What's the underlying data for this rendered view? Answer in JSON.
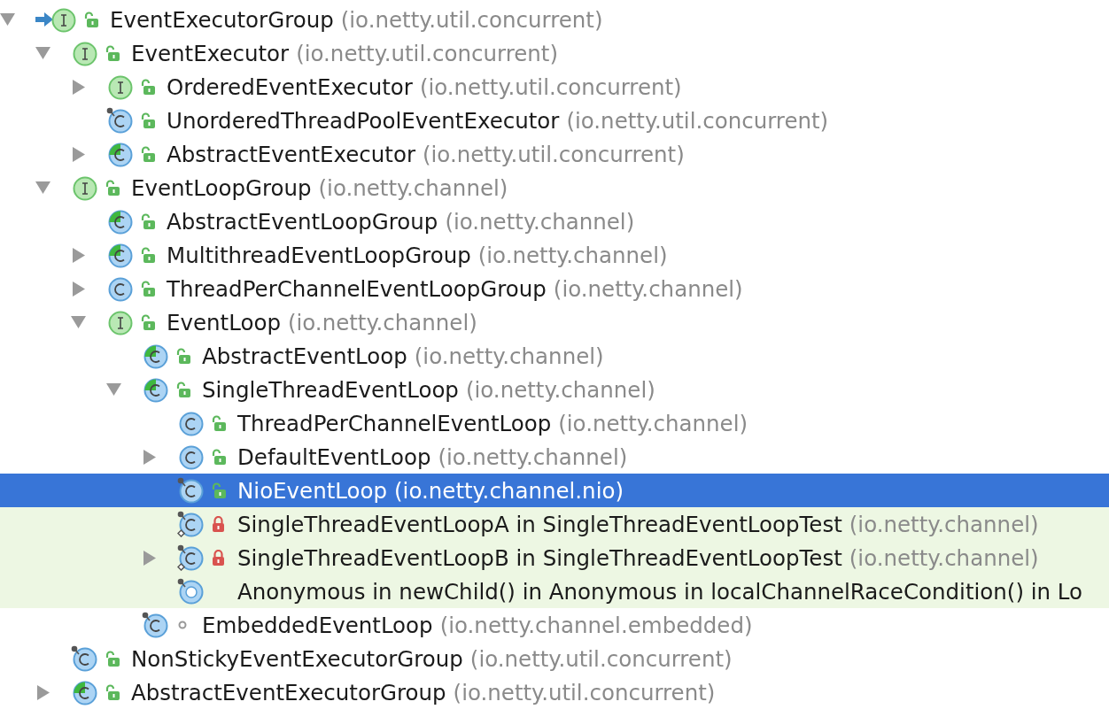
{
  "tree": [
    {
      "name": "EventExecutorGroup",
      "package": "(io.netty.util.concurrent)",
      "kind": "interface",
      "modifier": {
        "kind": "public"
      },
      "base": true,
      "final": false,
      "selected": false,
      "expanded": true,
      "children": [
        {
          "name": "EventExecutor",
          "package": "(io.netty.util.concurrent)",
          "kind": "interface",
          "modifier": {
            "kind": "public"
          },
          "final": false,
          "selected": false,
          "expanded": true,
          "children": [
            {
              "name": "OrderedEventExecutor",
              "package": "(io.netty.util.concurrent)",
              "kind": "interface",
              "modifier": {
                "kind": "public"
              },
              "final": false,
              "selected": false,
              "expanded": false
            },
            {
              "name": "UnorderedThreadPoolEventExecutor",
              "package": "(io.netty.util.concurrent)",
              "kind": "class",
              "modifier": {
                "kind": "public"
              },
              "final": true,
              "selected": false
            },
            {
              "name": "AbstractEventExecutor",
              "package": "(io.netty.util.concurrent)",
              "kind": "abstract",
              "modifier": {
                "kind": "public"
              },
              "final": false,
              "selected": false,
              "expanded": false
            }
          ]
        },
        {
          "name": "EventLoopGroup",
          "package": "(io.netty.channel)",
          "kind": "interface",
          "modifier": {
            "kind": "public"
          },
          "final": false,
          "selected": false,
          "expanded": true,
          "children": [
            {
              "name": "AbstractEventLoopGroup",
              "package": "(io.netty.channel)",
              "kind": "abstract",
              "modifier": {
                "kind": "public"
              },
              "final": false,
              "selected": false
            },
            {
              "name": "MultithreadEventLoopGroup",
              "package": "(io.netty.channel)",
              "kind": "abstract",
              "modifier": {
                "kind": "public"
              },
              "final": false,
              "selected": false,
              "expanded": false
            },
            {
              "name": "ThreadPerChannelEventLoopGroup",
              "package": "(io.netty.channel)",
              "kind": "class",
              "modifier": {
                "kind": "public"
              },
              "final": false,
              "selected": false,
              "expanded": false
            },
            {
              "name": "EventLoop",
              "package": "(io.netty.channel)",
              "kind": "interface",
              "modifier": {
                "kind": "public"
              },
              "final": false,
              "selected": false,
              "expanded": true,
              "children": [
                {
                  "name": "AbstractEventLoop",
                  "package": "(io.netty.channel)",
                  "kind": "abstract",
                  "modifier": {
                    "kind": "public"
                  },
                  "final": false,
                  "selected": false
                },
                {
                  "name": "SingleThreadEventLoop",
                  "package": "(io.netty.channel)",
                  "kind": "abstract",
                  "modifier": {
                    "kind": "public"
                  },
                  "final": false,
                  "selected": false,
                  "expanded": true,
                  "children": [
                    {
                      "name": "ThreadPerChannelEventLoop",
                      "package": "(io.netty.channel)",
                      "kind": "class",
                      "modifier": {
                        "kind": "public"
                      },
                      "final": false,
                      "selected": false
                    },
                    {
                      "name": "DefaultEventLoop",
                      "package": "(io.netty.channel)",
                      "kind": "class",
                      "modifier": {
                        "kind": "public"
                      },
                      "final": false,
                      "selected": false,
                      "expanded": false
                    },
                    {
                      "name": "NioEventLoop",
                      "package": "(io.netty.channel.nio)",
                      "kind": "class",
                      "modifier": {
                        "kind": "public"
                      },
                      "final": true,
                      "selected": true
                    },
                    {
                      "name": "SingleThreadEventLoopA in SingleThreadEventLoopTest",
                      "package": "(io.netty.channel)",
                      "kind": "class",
                      "modifier": {
                        "kind": "private"
                      },
                      "final": true,
                      "local": true,
                      "in_tests": true,
                      "selected": false
                    },
                    {
                      "name": "SingleThreadEventLoopB in SingleThreadEventLoopTest",
                      "package": "(io.netty.channel)",
                      "kind": "class",
                      "modifier": {
                        "kind": "private"
                      },
                      "final": true,
                      "local": true,
                      "in_tests": true,
                      "selected": false,
                      "expanded": false
                    },
                    {
                      "name": "Anonymous in newChild() in Anonymous in localChannelRaceCondition() in Lo",
                      "kind": "anonymous",
                      "final": true,
                      "in_tests": true,
                      "selected": false
                    }
                  ]
                },
                {
                  "name": "EmbeddedEventLoop",
                  "package": "(io.netty.channel.embedded)",
                  "kind": "class",
                  "modifier": {
                    "kind": "package"
                  },
                  "final": true,
                  "selected": false
                }
              ]
            }
          ]
        },
        {
          "name": "NonStickyEventExecutorGroup",
          "package": "(io.netty.util.concurrent)",
          "kind": "class",
          "modifier": {
            "kind": "public"
          },
          "final": true,
          "selected": false
        },
        {
          "name": "AbstractEventExecutorGroup",
          "package": "(io.netty.util.concurrent)",
          "kind": "abstract",
          "modifier": {
            "kind": "public"
          },
          "final": false,
          "selected": false,
          "expanded": false
        }
      ]
    }
  ]
}
